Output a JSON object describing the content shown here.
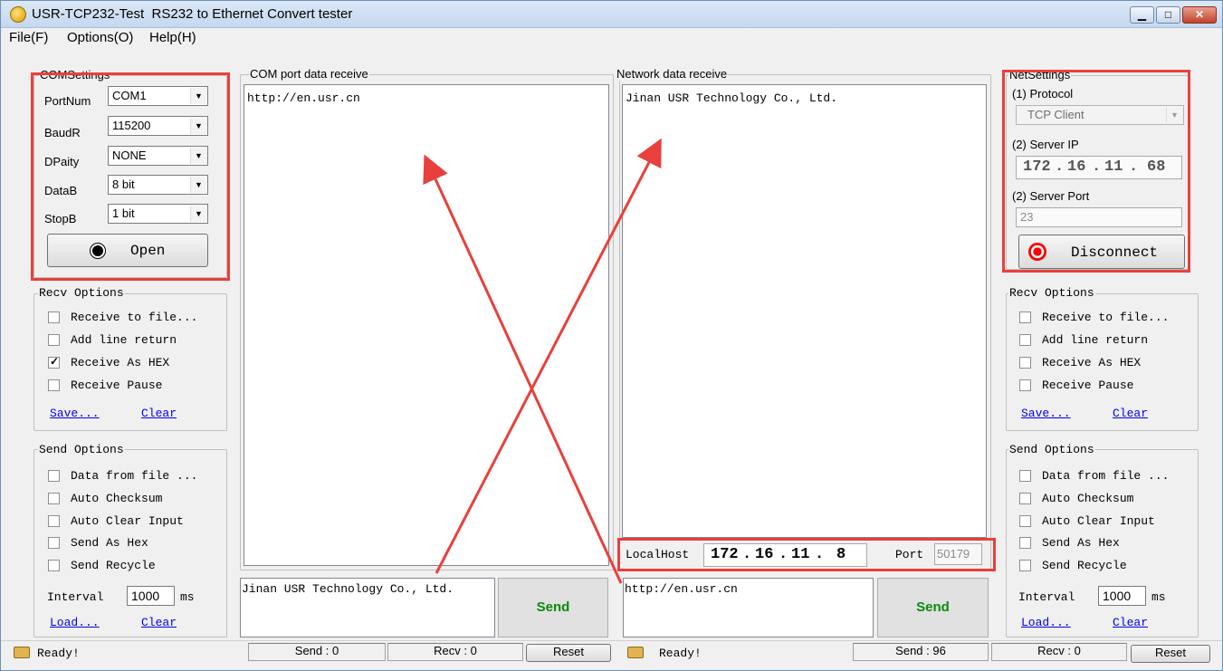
{
  "window": {
    "title": "USR-TCP232-Test  RS232 to Ethernet Convert tester",
    "min_glyph": "▁",
    "max_glyph": "□",
    "close_glyph": "✕"
  },
  "menu": [
    "File(F)",
    "Options(O)",
    "Help(H)"
  ],
  "com_settings": {
    "title": "COMSettings",
    "rows": [
      {
        "label": "PortNum",
        "value": "COM1"
      },
      {
        "label": "BaudR",
        "value": "115200"
      },
      {
        "label": "DPaity",
        "value": "NONE"
      },
      {
        "label": "DataB",
        "value": "8 bit"
      },
      {
        "label": "StopB",
        "value": "1 bit"
      }
    ],
    "open_label": "Open"
  },
  "net_settings": {
    "title": "NetSettings",
    "protocol_label": "(1) Protocol",
    "protocol_value": "TCP Client",
    "server_ip_label": "(2) Server IP",
    "server_ip_octets": [
      "172",
      "16",
      "11",
      "68"
    ],
    "server_port_label": "(2) Server Port",
    "server_port_value": "23",
    "disconnect_label": "Disconnect"
  },
  "recv_options": {
    "title": "Recv Options",
    "left": [
      {
        "label": "Receive to file...",
        "checked": false
      },
      {
        "label": "Add line return",
        "checked": false
      },
      {
        "label": "Receive As HEX",
        "checked": true
      },
      {
        "label": "Receive Pause",
        "checked": false
      }
    ],
    "right": [
      {
        "label": "Receive to file...",
        "checked": false
      },
      {
        "label": "Add line return",
        "checked": false
      },
      {
        "label": "Receive As HEX",
        "checked": false
      },
      {
        "label": "Receive Pause",
        "checked": false
      }
    ],
    "save_label": "Save...",
    "clear_label": "Clear"
  },
  "send_options": {
    "title": "Send Options",
    "items": [
      {
        "label": "Data from file ...",
        "checked": false
      },
      {
        "label": "Auto Checksum",
        "checked": false
      },
      {
        "label": "Auto Clear Input",
        "checked": false
      },
      {
        "label": "Send As Hex",
        "checked": false
      },
      {
        "label": "Send Recycle",
        "checked": false
      }
    ],
    "interval_label": "Interval",
    "interval_value": "1000",
    "interval_unit": "ms",
    "load_label": "Load...",
    "clear_label": "Clear"
  },
  "com_receive": {
    "title": "COM port data receive",
    "text": "http://en.usr.cn"
  },
  "net_receive": {
    "title": "Network data receive",
    "text": "Jinan USR Technology Co., Ltd."
  },
  "com_send": {
    "text": "Jinan USR Technology Co., Ltd.",
    "send_label": "Send"
  },
  "net_send": {
    "text": "http://en.usr.cn",
    "send_label": "Send"
  },
  "localhost": {
    "label": "LocalHost",
    "ip_octets": [
      "172",
      "16",
      "11",
      "8"
    ],
    "port_label": "Port",
    "port_value": "50179"
  },
  "status_left": {
    "ready": "Ready!",
    "send": "Send : 0",
    "recv": "Recv : 0",
    "reset": "Reset"
  },
  "status_right": {
    "ready": "Ready!",
    "send": "Send : 96",
    "recv": "Recv : 0",
    "reset": "Reset"
  },
  "colors": {
    "annotation_red": "#e8403c",
    "send_green": "#0a8a0a",
    "link_blue": "#0000ee"
  },
  "icons": [
    "app-icon",
    "minimize-icon",
    "maximize-icon",
    "close-icon",
    "open-port-icon",
    "disconnect-icon",
    "ready-hand-icon",
    "dropdown-arrow-icon",
    "checkmark-icon"
  ]
}
